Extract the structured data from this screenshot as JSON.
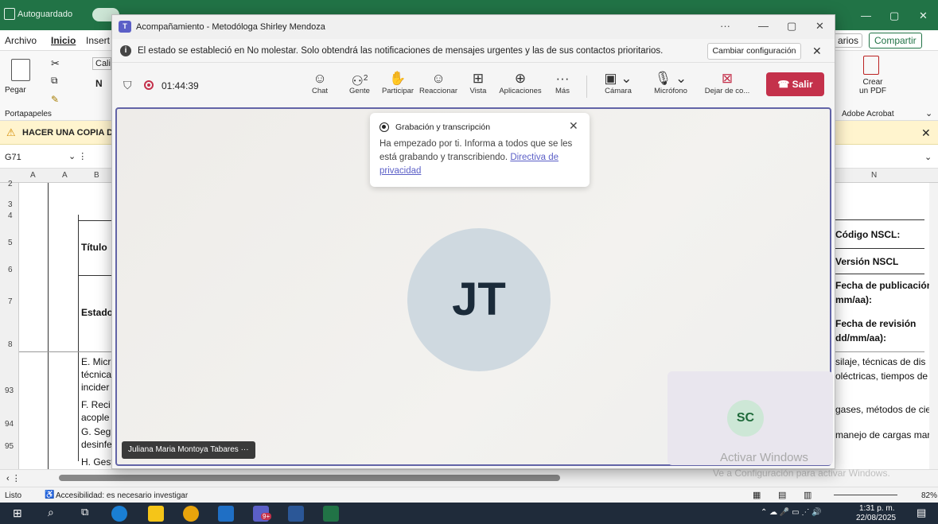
{
  "excel": {
    "autosave_label": "Autoguardado",
    "tabs": [
      "Archivo",
      "Inicio",
      "Insertar"
    ],
    "share_label": "Compartir",
    "comments_label": "arios",
    "clipboard": {
      "paste_label": "Pegar",
      "group_label": "Portapapeles"
    },
    "font_partial": "Calib",
    "bold_btn": "N",
    "warning_text": "HACER UNA COPIA D",
    "cell_ref": "G71",
    "pdf": {
      "create_label": "Crear\nun PDF",
      "group_label": "Adobe Acrobat"
    },
    "col_headers": [
      "A",
      "A",
      "B",
      "N"
    ],
    "row_headers": [
      "2",
      "3",
      "4",
      "5",
      "6",
      "7",
      "8",
      "93",
      "94",
      "95"
    ],
    "cells_left": [
      "Título",
      "Estado",
      "E. Micr",
      "técnica",
      "incider",
      "F. Reci",
      "acople",
      "G. Segu",
      "desinfe",
      "H. Gesti"
    ],
    "cells_right": [
      "Código NSCL:",
      "Versión NSCL",
      "Fecha de publicación",
      "mm/aa):",
      "Fecha de revisión",
      "dd/mm/aa):",
      "silaje, técnicas de dis",
      "oléctricas, tiempos de",
      "gases, métodos de ciei",
      "manejo de cargas mar"
    ],
    "status_ready": "Listo",
    "accessibility": "Accesibilidad: es necesario investigar",
    "zoom": "82%",
    "activate_windows": "Activar Windows",
    "activate_windows_sub": "Ve a Configuración para activar Windows."
  },
  "teams": {
    "window_title": "Acompañamiento - Metodóloga Shirley Mendoza",
    "notice": "El estado se estableció en No molestar. Solo obtendrá las notificaciones de mensajes urgentes y las de sus contactos prioritarios.",
    "change_settings": "Cambiar configuración",
    "timer": "01:44:39",
    "people_count": "2",
    "toolbar": [
      {
        "label": "Chat",
        "icon": "chat-icon"
      },
      {
        "label": "Gente",
        "icon": "people-icon"
      },
      {
        "label": "Participar",
        "icon": "raise-hand-icon"
      },
      {
        "label": "Reaccionar",
        "icon": "smile-icon"
      },
      {
        "label": "Vista",
        "icon": "grid-icon"
      },
      {
        "label": "Aplicaciones",
        "icon": "plus-icon"
      },
      {
        "label": "Más",
        "icon": "more-icon"
      }
    ],
    "camera_label": "Cámara",
    "mic_label": "Micrófono",
    "share_label": "Dejar de co...",
    "leave_label": "Salir",
    "popup": {
      "title": "Grabación y transcripción",
      "body": "Ha empezado por ti. Informa a todos que se les está grabando y transcribiendo.",
      "link": "Directiva de privacidad"
    },
    "main_initials": "JT",
    "self_initials": "SC",
    "participant_name": "Juliana Maria Montoya Tabares",
    "name_more": "···"
  },
  "taskbar": {
    "time": "1:31 p. m.",
    "date": "22/08/2025",
    "teams_badge": "9+"
  },
  "colors": {
    "excel_green": "#217346",
    "teams_purple": "#6264a7",
    "leave_red": "#c4314b"
  }
}
